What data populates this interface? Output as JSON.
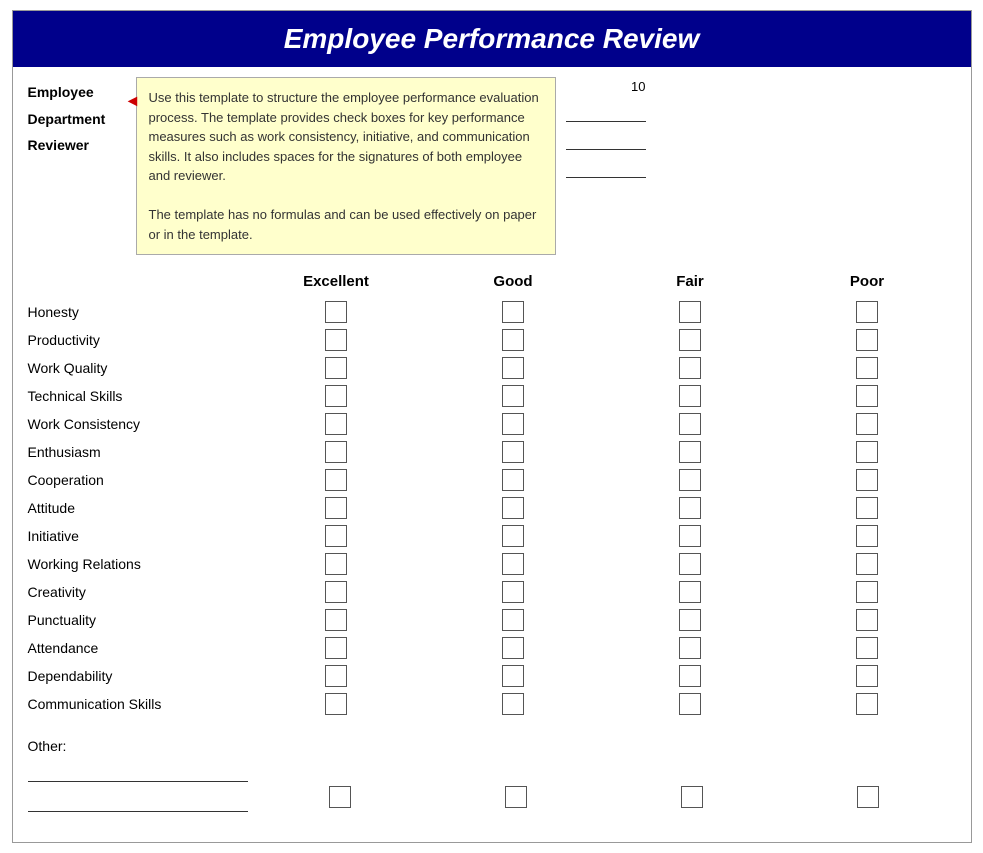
{
  "title": "Employee Performance Review",
  "tooltip": {
    "line1": "Use this template to structure the employee performance evaluation process.",
    "line2": "The template provides check boxes for key performance measures such as",
    "line3": "work consistency, initiative, and communication skills. It also includes spaces",
    "line4": "for the signatures of both employee and reviewer.",
    "line5": "",
    "line6": "The template has no formulas and can be used effectively on paper or in the template."
  },
  "info_labels": [
    "Employee",
    "Department",
    "Reviewer"
  ],
  "date_label": "10",
  "column_headers": [
    "Excellent",
    "Good",
    "Fair",
    "Poor"
  ],
  "criteria": [
    "Honesty",
    "Productivity",
    "Work Quality",
    "Technical Skills",
    "Work Consistency",
    "Enthusiasm",
    "Cooperation",
    "Attitude",
    "Initiative",
    "Working Relations",
    "Creativity",
    "Punctuality",
    "Attendance",
    "Dependability",
    "Communication Skills"
  ],
  "other_label": "Other:"
}
